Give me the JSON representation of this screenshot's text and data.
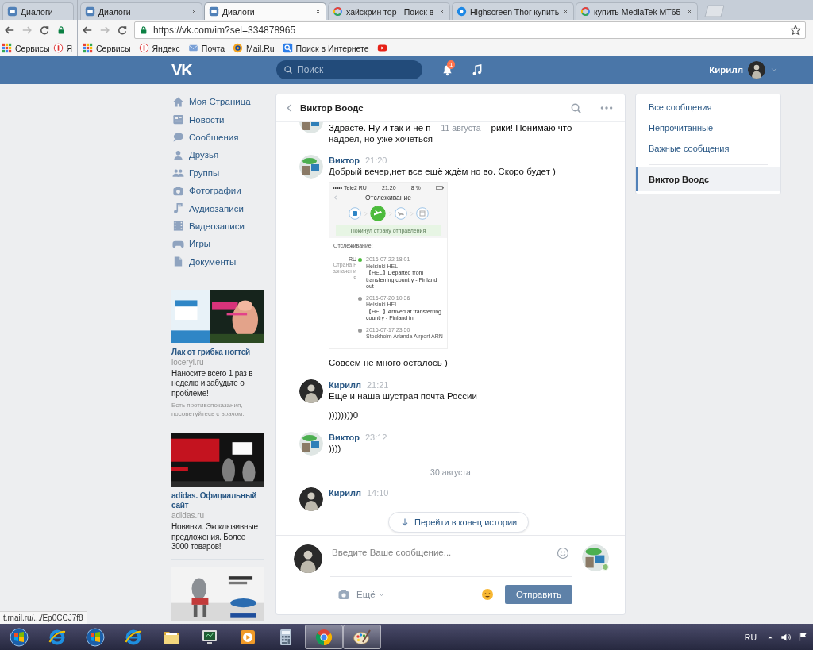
{
  "back_window": {
    "tab": {
      "title": "Диалоги",
      "kind": "vk"
    },
    "bookmarks": [
      {
        "kind": "apps",
        "label": "Сервисы"
      },
      {
        "kind": "yandex",
        "label": "Я"
      }
    ]
  },
  "browser": {
    "tabs": [
      {
        "title": "Диалоги",
        "kind": "vk",
        "selected": false
      },
      {
        "title": "Диалоги",
        "kind": "vk",
        "selected": true
      },
      {
        "title": "хайскрин тор - Поиск в",
        "kind": "google",
        "selected": false
      },
      {
        "title": "Highscreen Thor купить",
        "kind": "h",
        "selected": false
      },
      {
        "title": "купить MediaTek MT65",
        "kind": "google",
        "selected": false
      }
    ],
    "url": "https://vk.com/im?sel=334878965",
    "bookmarks": [
      {
        "kind": "apps",
        "label": "Сервисы"
      },
      {
        "kind": "yandex",
        "label": "Яндекс"
      },
      {
        "kind": "mail",
        "label": "Почта"
      },
      {
        "kind": "mailru",
        "label": "Mail.Ru"
      },
      {
        "kind": "search",
        "label": "Поиск в Интернете"
      },
      {
        "kind": "youtube"
      }
    ]
  },
  "header": {
    "logo": "VK",
    "search": {
      "placeholder": "Поиск"
    },
    "notifications": "1",
    "user": "Кирилл"
  },
  "nav": [
    {
      "kind": "home",
      "label": "Моя Страница"
    },
    {
      "kind": "news",
      "label": "Новости"
    },
    {
      "kind": "bubble",
      "label": "Сообщения"
    },
    {
      "kind": "person",
      "label": "Друзья"
    },
    {
      "kind": "people",
      "label": "Группы"
    },
    {
      "kind": "camera",
      "label": "Фотографии"
    },
    {
      "kind": "note",
      "label": "Аудиозаписи"
    },
    {
      "kind": "film",
      "label": "Видеозаписи"
    },
    {
      "kind": "gamepad",
      "label": "Игры"
    },
    {
      "kind": "doc",
      "label": "Документы"
    }
  ],
  "ads": [
    {
      "kind": "ad",
      "title": "Лак от грибка ногтей",
      "domain": "loceryl.ru",
      "text": "Наносите всего 1 раз в неделю и забудьте о проблеме!",
      "note": "Есть противопоказания, посоветуйтесь с врачом."
    },
    {
      "kind": "ad",
      "title": "adidas. Официальный сайт",
      "domain": "adidas.ru",
      "text": "Новинки. Эксклюзивные предложения. Более 3000 товаров!"
    },
    {
      "kind": "picture"
    }
  ],
  "chat": {
    "title": "Виктор Воодс",
    "messages": [
      {
        "kind": "group",
        "avatar": {
          "kind": "light"
        },
        "body": [
          {
            "kind": "split",
            "parts": [
              "Здрасте. Ну и так и не п",
              "рики! Понимаю что"
            ],
            "date": "11 августа"
          },
          {
            "kind": "text",
            "text": "надоел, но уже хочеться"
          }
        ]
      },
      {
        "kind": "group",
        "avatar": {
          "kind": "light"
        },
        "author": "Виктор",
        "time": "21:20",
        "body": [
          {
            "kind": "text",
            "text": "Добрый вечер,нет все ещё ждём но во. Скоро будет )"
          },
          {
            "kind": "attachment",
            "screenshot": {
              "status": [
                "••••• Tele2 RU",
                "21:20",
                "8 %"
              ],
              "title": "Отслеживание",
              "steps": [
                {
                  "kind": "box",
                  "selected": false
                },
                {
                  "kind": "plane_up",
                  "selected": true
                },
                {
                  "kind": "plane_down",
                  "selected": false
                },
                {
                  "kind": "calendar",
                  "selected": false
                }
              ],
              "banner": "Покинул страну отправления",
              "section": "Отслеживание:",
              "country": "RU",
              "country_note": "Страна назначения",
              "events": [
                {
                  "time": "2016-07-22 18:01",
                  "place": "Helsinki HEL",
                  "text": "【HEL】Departed from transferring country - Finland out",
                  "current": true
                },
                {
                  "time": "2016-07-20 10:36",
                  "place": "Helsinki HEL",
                  "text": "【HEL】Arrived at transferring country - Finland in",
                  "current": false
                },
                {
                  "time": "2016-07-17 23:50",
                  "place": "Stockholm Arlanda Airport ARN",
                  "current": false
                }
              ]
            }
          },
          {
            "kind": "text",
            "text": "Совсем не много осталось )"
          }
        ]
      },
      {
        "kind": "group",
        "avatar": {
          "kind": "dark"
        },
        "author": "Кирилл",
        "time": "21:21",
        "body": [
          {
            "kind": "text",
            "text": "Еще и наша шустрая почта России"
          },
          {
            "kind": "text",
            "text": "))))))))0"
          }
        ]
      },
      {
        "kind": "group",
        "avatar": {
          "kind": "light"
        },
        "author": "Виктор",
        "time": "23:12",
        "body": [
          {
            "kind": "text",
            "text": "))))"
          }
        ]
      },
      {
        "kind": "date",
        "text": "30 августа"
      },
      {
        "kind": "group",
        "avatar": {
          "kind": "dark"
        },
        "author": "Кирилл",
        "time": "14:10"
      }
    ],
    "jump_button": "Перейти в конец истории",
    "composer": {
      "placeholder": "Введите Ваше сообщение...",
      "more": "Ещё",
      "send": "Отправить",
      "own_avatar": {
        "kind": "dark"
      },
      "peer_avatar": {
        "kind": "light",
        "online": true
      }
    }
  },
  "folders": [
    {
      "kind": "folder",
      "label": "Все сообщения",
      "selected": false
    },
    {
      "kind": "folder",
      "label": "Непрочитанные",
      "selected": false
    },
    {
      "kind": "folder",
      "label": "Важные сообщения",
      "selected": false
    },
    {
      "kind": "dialog",
      "label": "Виктор Воодс",
      "selected": true
    }
  ],
  "status_url": "t.mail.ru/.../Ep0CCJ7f8",
  "taskbar": {
    "items": [
      {
        "kind": "start",
        "running": false
      },
      {
        "kind": "ie",
        "running": false
      },
      {
        "kind": "start",
        "running": false
      },
      {
        "kind": "ie",
        "running": false
      },
      {
        "kind": "folder",
        "running": false
      },
      {
        "kind": "monitor",
        "running": false
      },
      {
        "kind": "media",
        "running": false
      },
      {
        "kind": "calc",
        "running": false
      },
      {
        "kind": "chrome",
        "running": true
      },
      {
        "kind": "paint",
        "running": true
      }
    ],
    "language": "RU"
  }
}
